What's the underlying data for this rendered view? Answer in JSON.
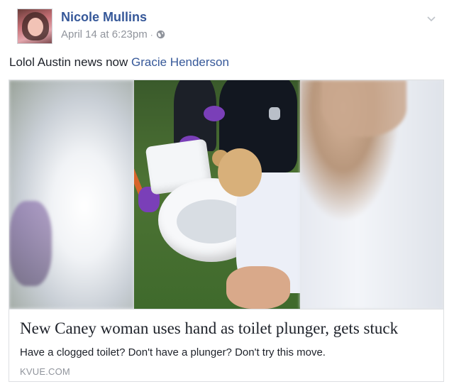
{
  "post": {
    "author": "Nicole Mullins",
    "timestamp": "April 14 at 6:23pm",
    "separator": "·",
    "privacy_icon": "globe-icon",
    "options_icon": "chevron-down-icon",
    "text": "Lolol Austin news now ",
    "tagged_person": "Gracie Henderson"
  },
  "link_card": {
    "image_icon": "toilet-photo",
    "headline": "New Caney woman uses hand as toilet plunger, gets stuck",
    "description": "Have a clogged toilet? Don't have a plunger? Don't try this move.",
    "domain": "KVUE.COM"
  },
  "colors": {
    "link": "#365899",
    "text": "#1d2129",
    "meta": "#90949c",
    "border": "#dddfe2"
  }
}
